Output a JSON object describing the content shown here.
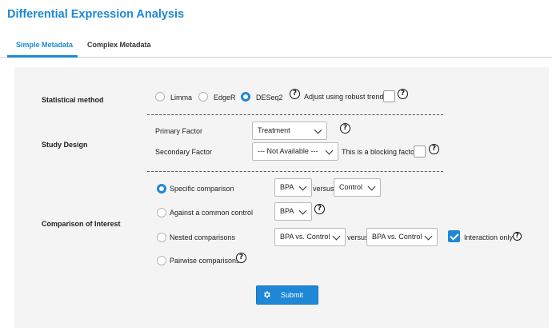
{
  "title": "Differential Expression Analysis",
  "tabs": [
    {
      "label": "Simple Metadata",
      "active": true
    },
    {
      "label": "Complex Metadata",
      "active": false
    }
  ],
  "statistical_method": {
    "label": "Statistical method",
    "options": [
      "Limma",
      "EdgeR",
      "DESeq2"
    ],
    "selected": "DESeq2",
    "robust_trend_label": "Adjust using robust trend",
    "robust_trend_checked": false
  },
  "study_design": {
    "label": "Study Design",
    "primary_factor_label": "Primary Factor",
    "primary_factor_value": "Treatment",
    "secondary_factor_label": "Secondary Factor",
    "secondary_factor_value": "--- Not Available ---",
    "blocking_factor_label": "This is a blocking factor",
    "blocking_factor_checked": false
  },
  "comparison": {
    "label": "Comparison of Interest",
    "selected": "Specific comparison",
    "specific_label": "Specific comparison",
    "specific_left": "BPA",
    "versus": "versus",
    "specific_right": "Control",
    "common_control_label": "Against a common control",
    "common_control_value": "BPA",
    "nested_label": "Nested comparisons",
    "nested_left": "BPA vs. Control",
    "nested_right": "BPA vs. Control",
    "interaction_only_label": "Interaction only",
    "interaction_only_checked": true,
    "pairwise_label": "Pairwise comparisons"
  },
  "submit_label": "Submit",
  "help_glyph": "?",
  "colors": {
    "accent": "#1e88d6",
    "panel": "#f4f4f4"
  }
}
